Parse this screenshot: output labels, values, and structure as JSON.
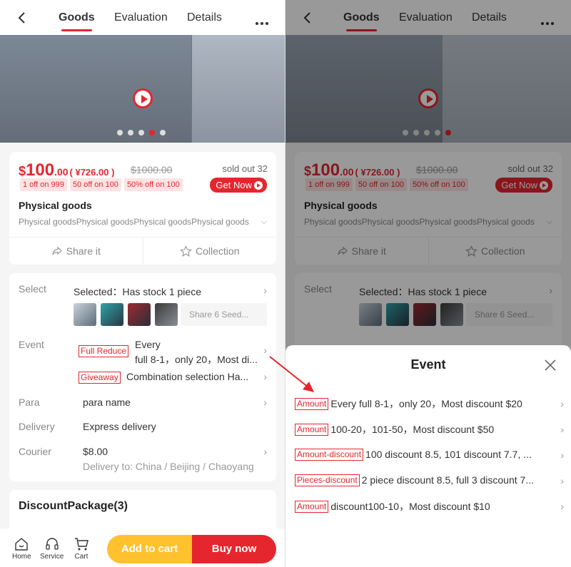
{
  "colors": {
    "accent": "#e5262f",
    "cart": "#ffc12e"
  },
  "nav": {
    "tabs": [
      "Goods",
      "Evaluation",
      "Details"
    ]
  },
  "product": {
    "currency": "$",
    "price_int": "100",
    "price_dec": ".00",
    "price_rmb": "( ¥726.00 )",
    "orig_price": "$1000.00",
    "sold": "sold out 32",
    "tags": [
      "1 off on 999",
      "50 off on 100",
      "50% off on 100"
    ],
    "get_now": "Get Now",
    "name": "Physical goods",
    "desc": "Physical goodsPhysical goodsPhysical goodsPhysical goods",
    "share": "Share it",
    "collection": "Collection"
  },
  "options": {
    "select_label": "Select",
    "selected": "Selected：Has stock   1  piece",
    "share_seed": "Share 6 Seed...",
    "event_label": "Event",
    "event1_tag": "Full Reduce",
    "event1_line1": "Every",
    "event1_line2": "full 8-1，only 20，Most di...",
    "event2_tag": "Giveaway",
    "event2_text": "Combination selection    Ha...",
    "para_label": "Para",
    "para_value": "para name",
    "delivery_label": "Delivery",
    "delivery_value": "Express delivery",
    "courier_label": "Courier",
    "courier_value": "$8.00",
    "courier_sub": "Delivery to: China / Beijing / Chaoyang"
  },
  "package": {
    "title": "DiscountPackage(3)"
  },
  "bottom": {
    "home": "Home",
    "service": "Service",
    "cart": "Cart",
    "add_cart": "Add to cart",
    "buy_now": "Buy now"
  },
  "sheet": {
    "title": "Event",
    "items": [
      {
        "tag": "Amount",
        "text": "Every full 8-1，only 20，Most discount $20"
      },
      {
        "tag": "Amount",
        "text": "100-20，101-50，Most discount $50"
      },
      {
        "tag": "Amount-discount",
        "text": "100 discount 8.5, 101 discount 7.7, ..."
      },
      {
        "tag": "Pieces-discount",
        "text": "2 piece discount 8.5, full 3 discount 7..."
      },
      {
        "tag": "Amount",
        "text": "discount100-10，Most discount $10"
      }
    ]
  }
}
